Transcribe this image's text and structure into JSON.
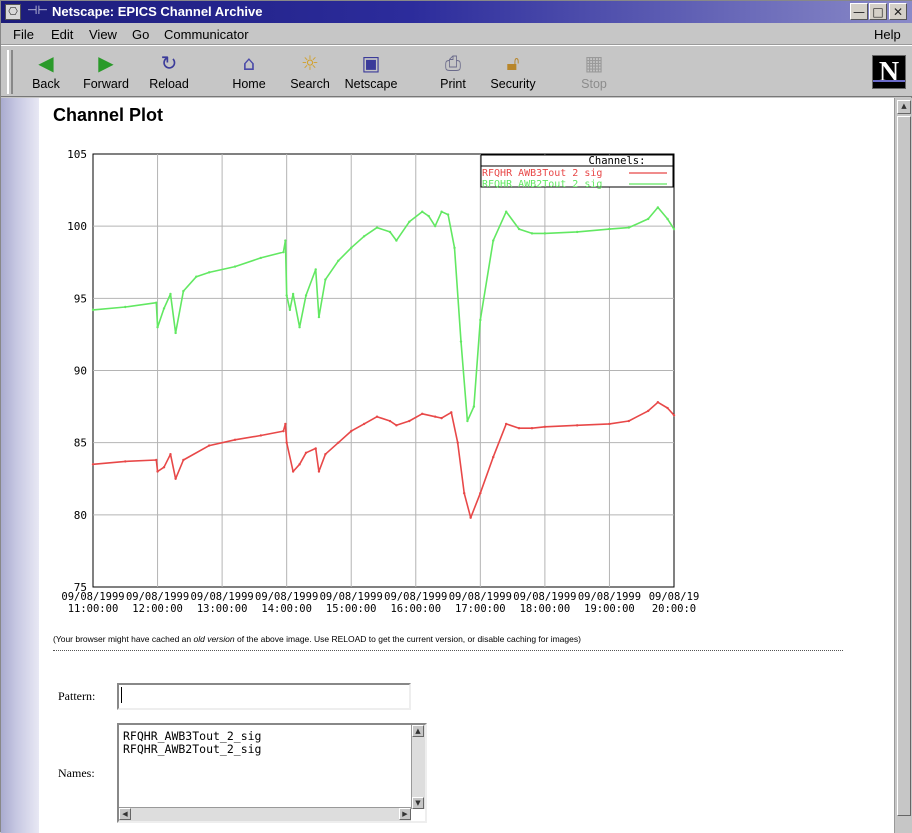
{
  "window": {
    "title": "Netscape: EPICS Channel Archive",
    "pin_glyph": "⊣⊢",
    "controls": {
      "minimize": "—",
      "maximize": "□",
      "close": "✕"
    }
  },
  "menu": {
    "file": "File",
    "edit": "Edit",
    "view": "View",
    "go": "Go",
    "communicator": "Communicator",
    "help": "Help"
  },
  "toolbar": {
    "back": "Back",
    "forward": "Forward",
    "reload": "Reload",
    "home": "Home",
    "search": "Search",
    "netscape": "Netscape",
    "print": "Print",
    "security": "Security",
    "stop": "Stop",
    "logo": "N"
  },
  "page": {
    "title": "Channel Plot",
    "cache_note_pre": "(Your browser might have cached an ",
    "cache_note_em": "old version",
    "cache_note_post": " of the above image. Use RELOAD to get the current version, or disable caching for images)",
    "pattern_label": "Pattern:",
    "pattern_value": "",
    "names_label": "Names:",
    "names": [
      "RFQHR_AWB3Tout_2_sig",
      "RFQHR_AWB2Tout_2_sig"
    ]
  },
  "chart_data": {
    "type": "line",
    "legend_title": "Channels:",
    "legend_position": "top-right",
    "grid": true,
    "ylim": [
      75,
      105
    ],
    "yticks": [
      75,
      80,
      85,
      90,
      95,
      100,
      105
    ],
    "xlim": [
      11.0,
      20.0
    ],
    "x_ticks": [
      11,
      12,
      13,
      14,
      15,
      16,
      17,
      18,
      19,
      20
    ],
    "x_tick_labels": [
      [
        "09/08/1999",
        "11:00:00"
      ],
      [
        "09/08/1999",
        "12:00:00"
      ],
      [
        "09/08/1999",
        "13:00:00"
      ],
      [
        "09/08/1999",
        "14:00:00"
      ],
      [
        "09/08/1999",
        "15:00:00"
      ],
      [
        "09/08/1999",
        "16:00:00"
      ],
      [
        "09/08/1999",
        "17:00:00"
      ],
      [
        "09/08/1999",
        "18:00:00"
      ],
      [
        "09/08/1999",
        "19:00:00"
      ],
      [
        "09/08/19",
        "20:00:0"
      ]
    ],
    "series": [
      {
        "name": "RFQHR_AWB3Tout_2_sig",
        "color": "#e84848",
        "x": [
          11.0,
          11.5,
          11.98,
          12.0,
          12.1,
          12.2,
          12.28,
          12.4,
          12.8,
          13.2,
          13.6,
          13.95,
          13.98,
          14.0,
          14.1,
          14.2,
          14.3,
          14.45,
          14.5,
          14.6,
          14.8,
          15.0,
          15.2,
          15.4,
          15.6,
          15.7,
          15.9,
          16.1,
          16.3,
          16.4,
          16.55,
          16.65,
          16.75,
          16.85,
          17.0,
          17.2,
          17.4,
          17.6,
          17.8,
          18.0,
          18.5,
          19.0,
          19.3,
          19.6,
          19.75,
          19.9,
          20.0
        ],
        "y": [
          83.5,
          83.7,
          83.8,
          83.0,
          83.3,
          84.2,
          82.5,
          83.8,
          84.8,
          85.2,
          85.5,
          85.8,
          86.3,
          85.0,
          83.0,
          83.5,
          84.3,
          84.6,
          83.0,
          84.2,
          85.0,
          85.8,
          86.3,
          86.8,
          86.5,
          86.2,
          86.5,
          87.0,
          86.8,
          86.7,
          87.1,
          85.0,
          81.5,
          79.8,
          81.5,
          84.0,
          86.3,
          86.0,
          86.0,
          86.1,
          86.2,
          86.3,
          86.5,
          87.2,
          87.8,
          87.4,
          86.9
        ]
      },
      {
        "name": "RFQHR_AWB2Tout_2_sig",
        "color": "#62e862",
        "x": [
          11.0,
          11.5,
          11.98,
          12.0,
          12.1,
          12.2,
          12.28,
          12.4,
          12.6,
          12.8,
          13.2,
          13.6,
          13.95,
          13.98,
          14.0,
          14.05,
          14.1,
          14.2,
          14.3,
          14.45,
          14.5,
          14.6,
          14.8,
          15.0,
          15.2,
          15.4,
          15.6,
          15.7,
          15.9,
          16.1,
          16.2,
          16.3,
          16.4,
          16.5,
          16.6,
          16.7,
          16.8,
          16.9,
          17.0,
          17.2,
          17.4,
          17.6,
          17.8,
          18.0,
          18.5,
          19.0,
          19.3,
          19.6,
          19.75,
          19.9,
          20.0
        ],
        "y": [
          94.2,
          94.4,
          94.7,
          93.0,
          94.3,
          95.3,
          92.6,
          95.5,
          96.5,
          96.8,
          97.2,
          97.8,
          98.2,
          99.0,
          95.2,
          94.2,
          95.3,
          93.0,
          95.2,
          97.0,
          93.7,
          96.3,
          97.6,
          98.5,
          99.3,
          99.9,
          99.6,
          99.0,
          100.3,
          101.0,
          100.7,
          100.0,
          101.0,
          100.8,
          98.5,
          92.0,
          86.5,
          87.5,
          93.5,
          99.0,
          101.0,
          99.8,
          99.5,
          99.5,
          99.6,
          99.8,
          99.9,
          100.5,
          101.3,
          100.5,
          99.8
        ]
      }
    ]
  }
}
